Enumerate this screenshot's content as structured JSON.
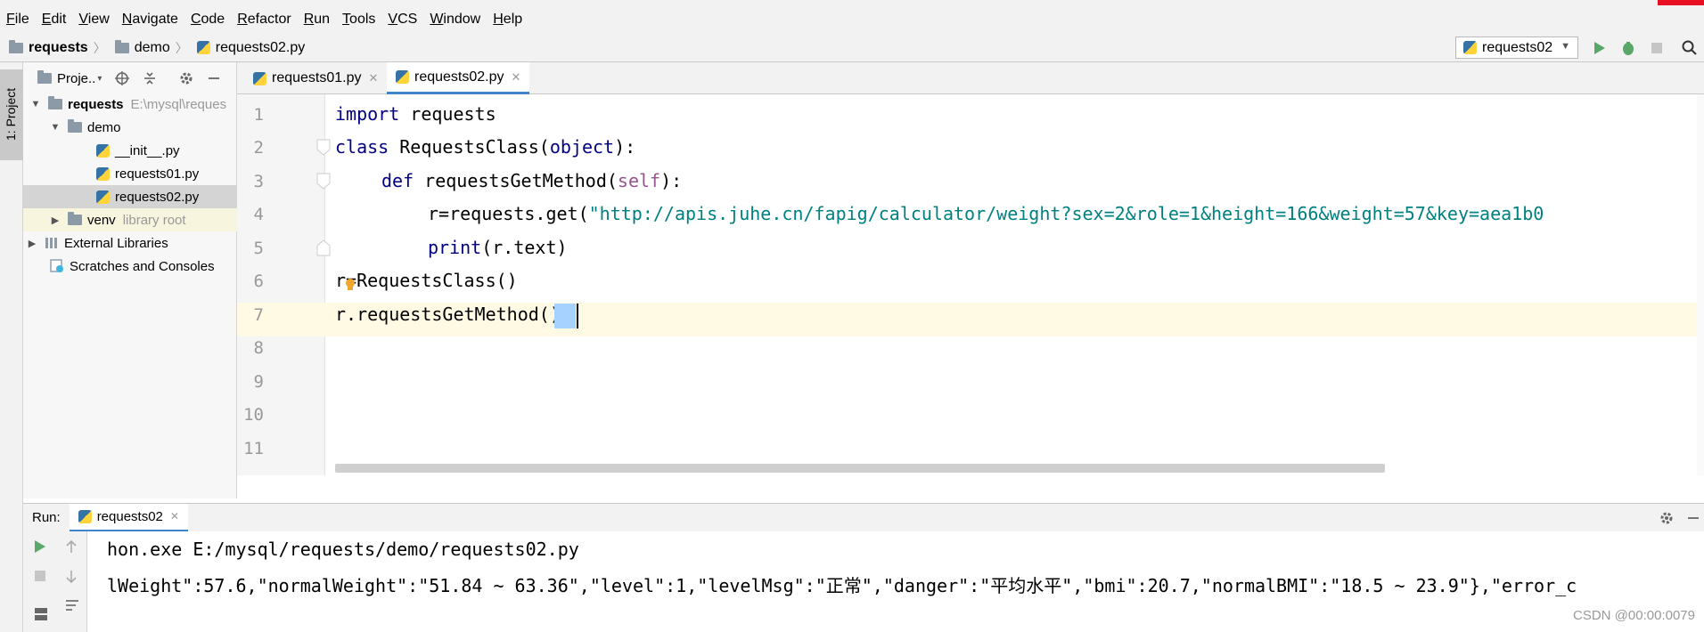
{
  "menu": [
    "File",
    "Edit",
    "View",
    "Navigate",
    "Code",
    "Refactor",
    "Run",
    "Tools",
    "VCS",
    "Window",
    "Help"
  ],
  "breadcrumb": [
    "requests",
    "demo",
    "requests02.py"
  ],
  "run_config": "requests02",
  "project_panel": {
    "title": "Proje..",
    "strip_label": "1: Project",
    "tree": [
      {
        "label": "requests",
        "extra": "E:\\mysql\\reques"
      },
      {
        "label": "demo"
      },
      {
        "label": "__init__.py"
      },
      {
        "label": "requests01.py"
      },
      {
        "label": "requests02.py"
      },
      {
        "label": "venv",
        "extra": "library root"
      },
      {
        "label": "External Libraries"
      },
      {
        "label": "Scratches and Consoles"
      }
    ]
  },
  "tabs": [
    {
      "label": "requests01.py"
    },
    {
      "label": "requests02.py"
    }
  ],
  "code": {
    "line_numbers": [
      "1",
      "2",
      "3",
      "4",
      "5",
      "6",
      "7",
      "8",
      "9",
      "10",
      "11"
    ],
    "l1_kw": "import",
    "l1_rest": " requests",
    "l2_kw": "class",
    "l2_name": " RequestsClass(",
    "l2_obj": "object",
    "l2_end": "):",
    "l3_kw": "def",
    "l3_name": " requestsGetMethod(",
    "l3_self": "self",
    "l3_end": "):",
    "l4_pre": "r=requests.get(",
    "l4_str": "\"http://apis.juhe.cn/fapig/calculator/weight?sex=2&role=1&height=166&weight=57&key=aea1b0",
    "l5_kw": "print",
    "l5_rest": "(r.text)",
    "l6": "r=RequestsClass()",
    "l7": "r.requestsGetMethod()"
  },
  "run_panel": {
    "label": "Run:",
    "tab": "requests02",
    "line1": "hon.exe E:/mysql/requests/demo/requests02.py",
    "line2": "lWeight\":57.6,\"normalWeight\":\"51.84 ~ 63.36\",\"level\":1,\"levelMsg\":\"正常\",\"danger\":\"平均水平\",\"bmi\":20.7,\"normalBMI\":\"18.5 ~ 23.9\"},\"error_c"
  },
  "watermark": "CSDN @00:00:0079"
}
